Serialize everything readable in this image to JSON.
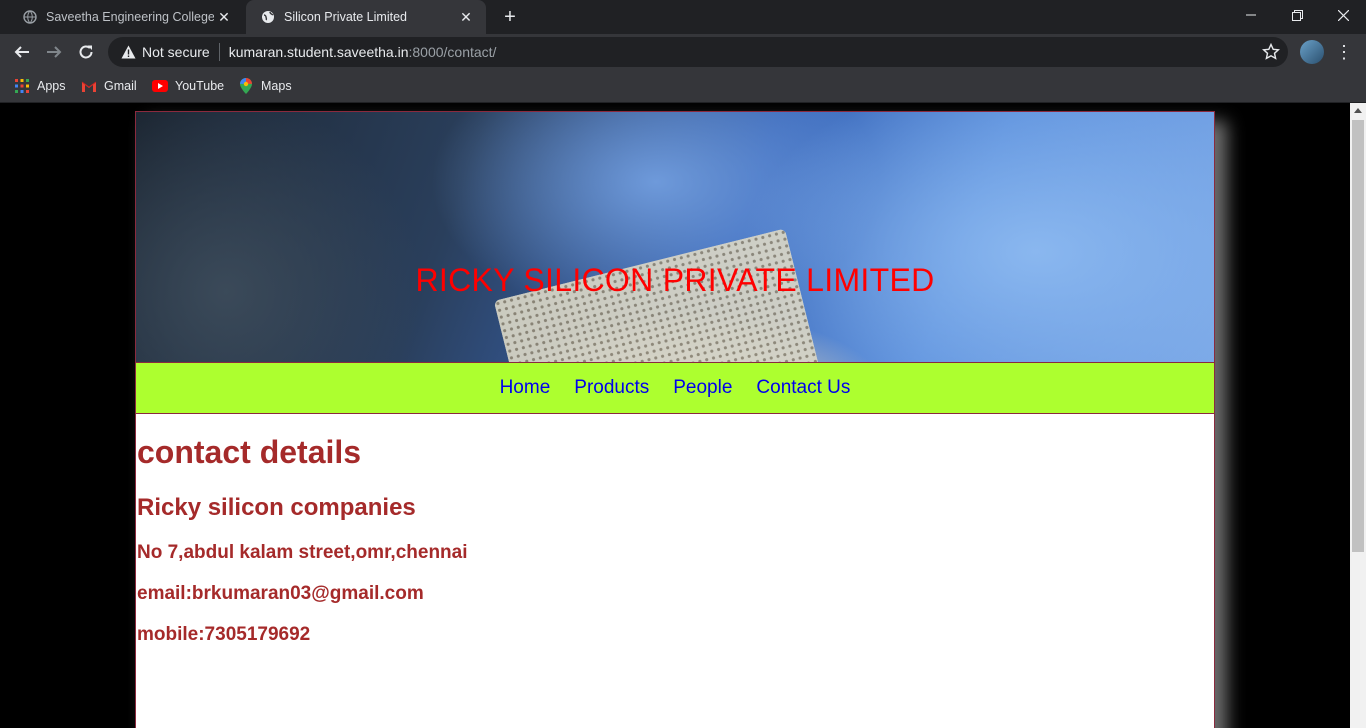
{
  "browser": {
    "tabs": [
      {
        "title": "Saveetha Engineering College",
        "active": false
      },
      {
        "title": "Silicon Private Limited",
        "active": true
      }
    ],
    "omnibox": {
      "security_label": "Not secure",
      "host": "kumaran.student.saveetha.in",
      "path": ":8000/contact/"
    },
    "bookmarks": [
      "Apps",
      "Gmail",
      "YouTube",
      "Maps"
    ]
  },
  "page": {
    "banner_title": "RICKY SILICON PRIVATE LIMITED",
    "nav": [
      "Home",
      "Products",
      "People",
      "Contact Us"
    ],
    "heading": "contact details",
    "company": "Ricky silicon companies",
    "address": "No 7,abdul kalam street,omr,chennai",
    "email": "email:brkumaran03@gmail.com",
    "mobile": "mobile:7305179692"
  },
  "colors": {
    "banner_title": "#ff0000",
    "nav_background": "#adff2f",
    "nav_link": "#0000ee",
    "content_text": "#a52a2a"
  }
}
